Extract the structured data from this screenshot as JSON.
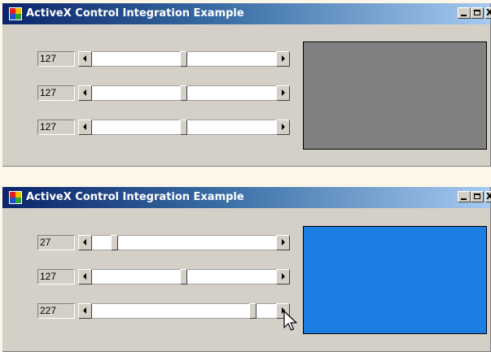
{
  "windows": [
    {
      "title": "ActiveX Control Integration Example",
      "sliders": [
        {
          "value": "127",
          "level": 127
        },
        {
          "value": "127",
          "level": 127
        },
        {
          "value": "127",
          "level": 127
        }
      ],
      "panel_color": "#808080"
    },
    {
      "title": "ActiveX Control Integration Example",
      "sliders": [
        {
          "value": "27",
          "level": 27
        },
        {
          "value": "127",
          "level": 127
        },
        {
          "value": "227",
          "level": 227
        }
      ],
      "panel_color": "#1c7de2"
    }
  ],
  "slider_range": [
    0,
    255
  ],
  "icons": {
    "app": "app-window-icon",
    "minimize": "minimize-icon",
    "maximize": "maximize-icon",
    "close": "close-icon",
    "scroll_left": "arrow-left-icon",
    "scroll_right": "arrow-right-icon",
    "cursor": "mouse-pointer-icon"
  },
  "controls": {
    "close_label": "X"
  }
}
